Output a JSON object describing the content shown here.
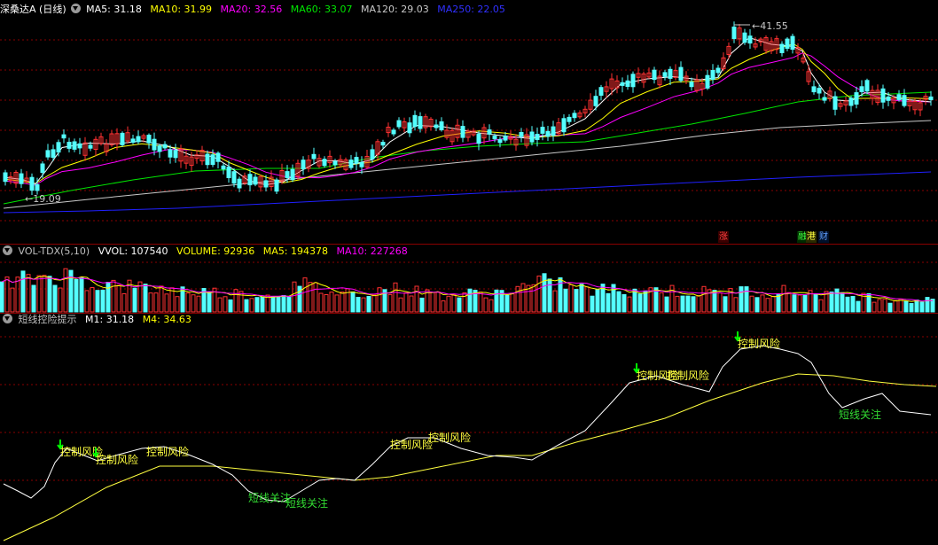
{
  "price_header": {
    "title": "深桑达A (日线)",
    "ma5": "MA5: 31.18",
    "ma10": "MA10: 31.99",
    "ma20": "MA20: 32.56",
    "ma60": "MA60: 33.07",
    "ma120": "MA120: 29.03",
    "ma250": "MA250: 22.05"
  },
  "price_annotations": {
    "high": "41.55",
    "low": "19.09"
  },
  "event_badges": {
    "zhang": "涨",
    "gang": "港",
    "zheng": "融",
    "cai": "财"
  },
  "volume_header": {
    "title": "VOL-TDX(5,10)",
    "vvol": "VVOL: 107540",
    "volume": "VOLUME: 92936",
    "ma5": "MA5: 194378",
    "ma10": "MA10: 227268"
  },
  "indicator_header": {
    "title": "短线控险提示",
    "m1": "M1: 31.18",
    "m4": "M4: 34.63"
  },
  "signal_text": {
    "risk": "控制风险",
    "watch": "短线关注"
  },
  "colors": {
    "up": "#ff3232",
    "down": "#54ffff",
    "ma5": "#ffffff",
    "ma10": "#ffff00",
    "ma20": "#ff00ff",
    "ma60": "#00e600",
    "ma120": "#c8c8c8",
    "ma250": "#2020ff",
    "grid": "#8a0000",
    "risk_label": "#ffff40",
    "watch_label": "#33dd33"
  }
}
